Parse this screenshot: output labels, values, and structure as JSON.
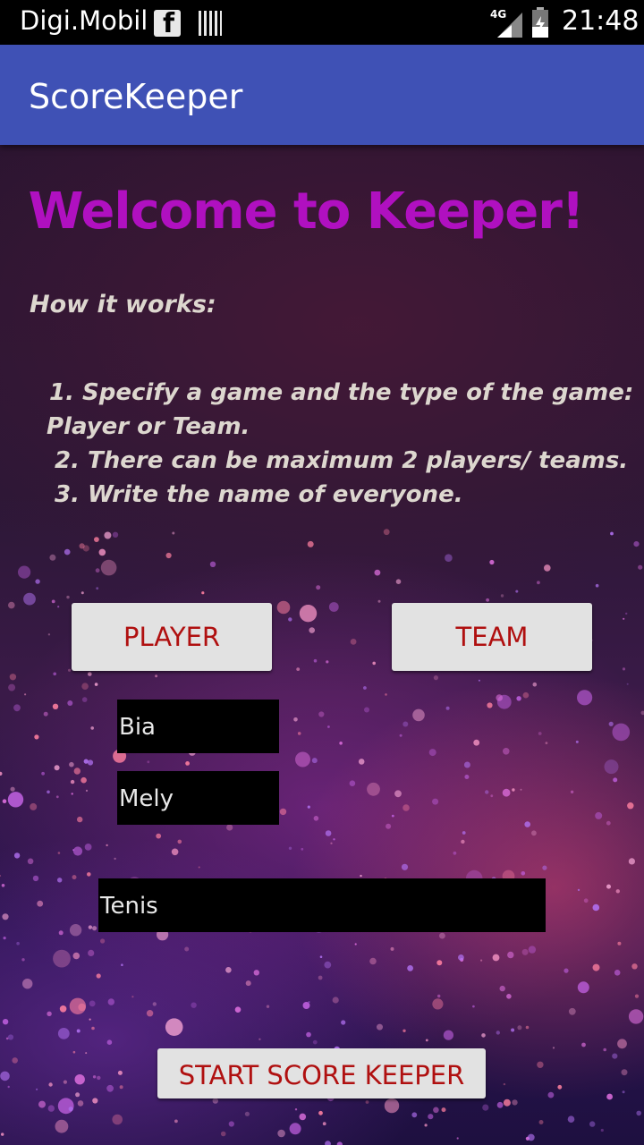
{
  "status_bar": {
    "carrier": "Digi.Mobil",
    "network": "4G",
    "time": "21:48",
    "icons": [
      "facebook-icon",
      "barcode-icon",
      "signal-icon",
      "battery-icon"
    ]
  },
  "app_bar": {
    "title": "ScoreKeeper",
    "color": "#3f51b5"
  },
  "main": {
    "welcome": "Welcome to Keeper!",
    "how_title": "How it works:",
    "steps": [
      "1. Specify a game and the type of the game:",
      "Player or Team.",
      "2. There can be maximum 2 players/ teams.",
      "3. Write the name of everyone."
    ],
    "player_button": "PLAYER",
    "team_button": "TEAM",
    "name_1": "Bia",
    "name_2": "Mely",
    "game_name": "Tenis",
    "start_button": "START SCORE KEEPER"
  },
  "colors": {
    "welcome": "#b010c0",
    "button_text": "#b01010",
    "button_bg": "#e2e2e2"
  }
}
